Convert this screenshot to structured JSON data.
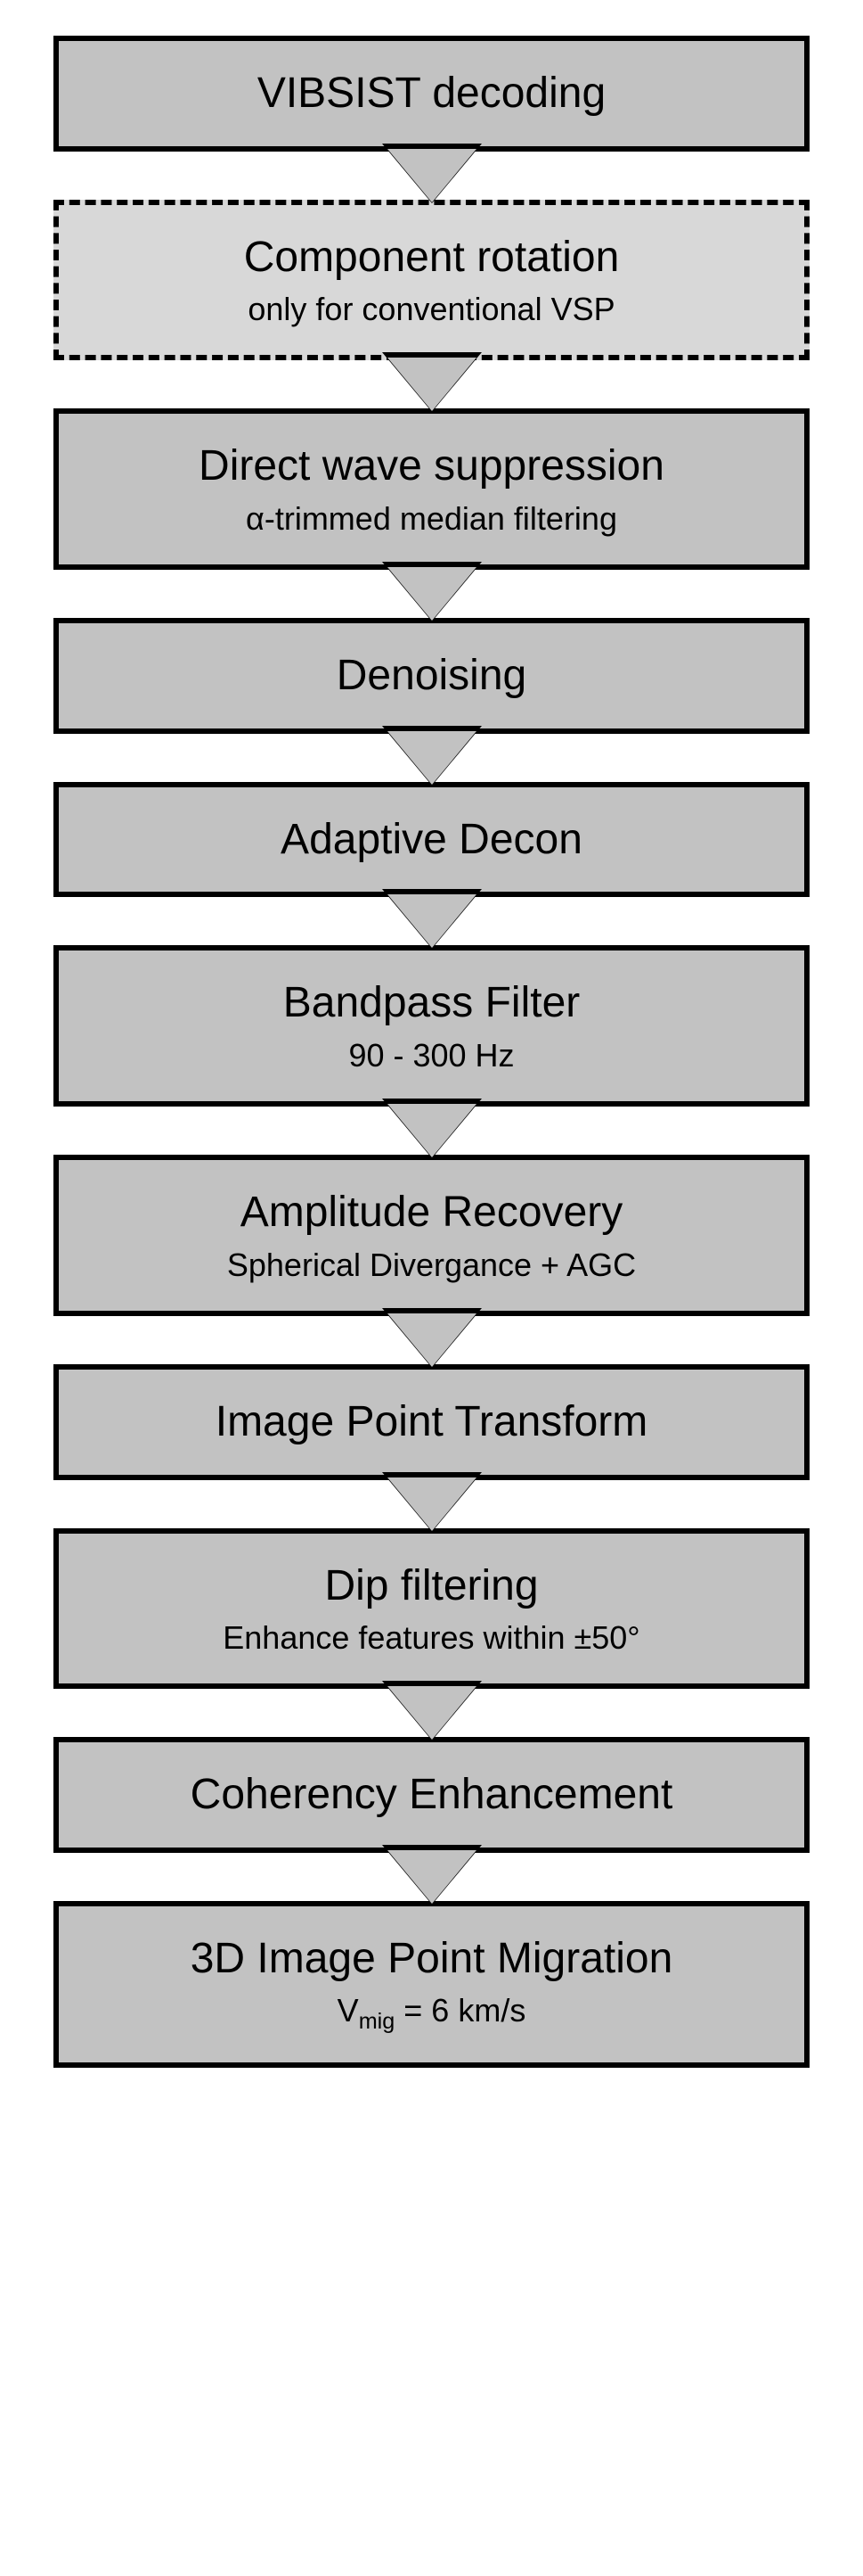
{
  "steps": [
    {
      "title": "VIBSIST decoding",
      "subtitle": "",
      "dashed": false
    },
    {
      "title": "Component rotation",
      "subtitle": "only for conventional VSP",
      "dashed": true
    },
    {
      "title": "Direct wave suppression",
      "subtitle": "α-trimmed median filtering",
      "dashed": false
    },
    {
      "title": "Denoising",
      "subtitle": "",
      "dashed": false
    },
    {
      "title": "Adaptive Decon",
      "subtitle": "",
      "dashed": false
    },
    {
      "title": "Bandpass Filter",
      "subtitle": "90 - 300 Hz",
      "dashed": false
    },
    {
      "title": "Amplitude Recovery",
      "subtitle": "Spherical Divergance + AGC",
      "dashed": false
    },
    {
      "title": "Image Point Transform",
      "subtitle": "",
      "dashed": false
    },
    {
      "title": "Dip filtering",
      "subtitle": "Enhance features within ±50°",
      "dashed": false
    },
    {
      "title": "Coherency Enhancement",
      "subtitle": "",
      "dashed": false
    },
    {
      "title": "3D Image Point Migration",
      "subtitle": "Vₘᵢ₉ = 6 km/s",
      "dashed": false
    }
  ]
}
